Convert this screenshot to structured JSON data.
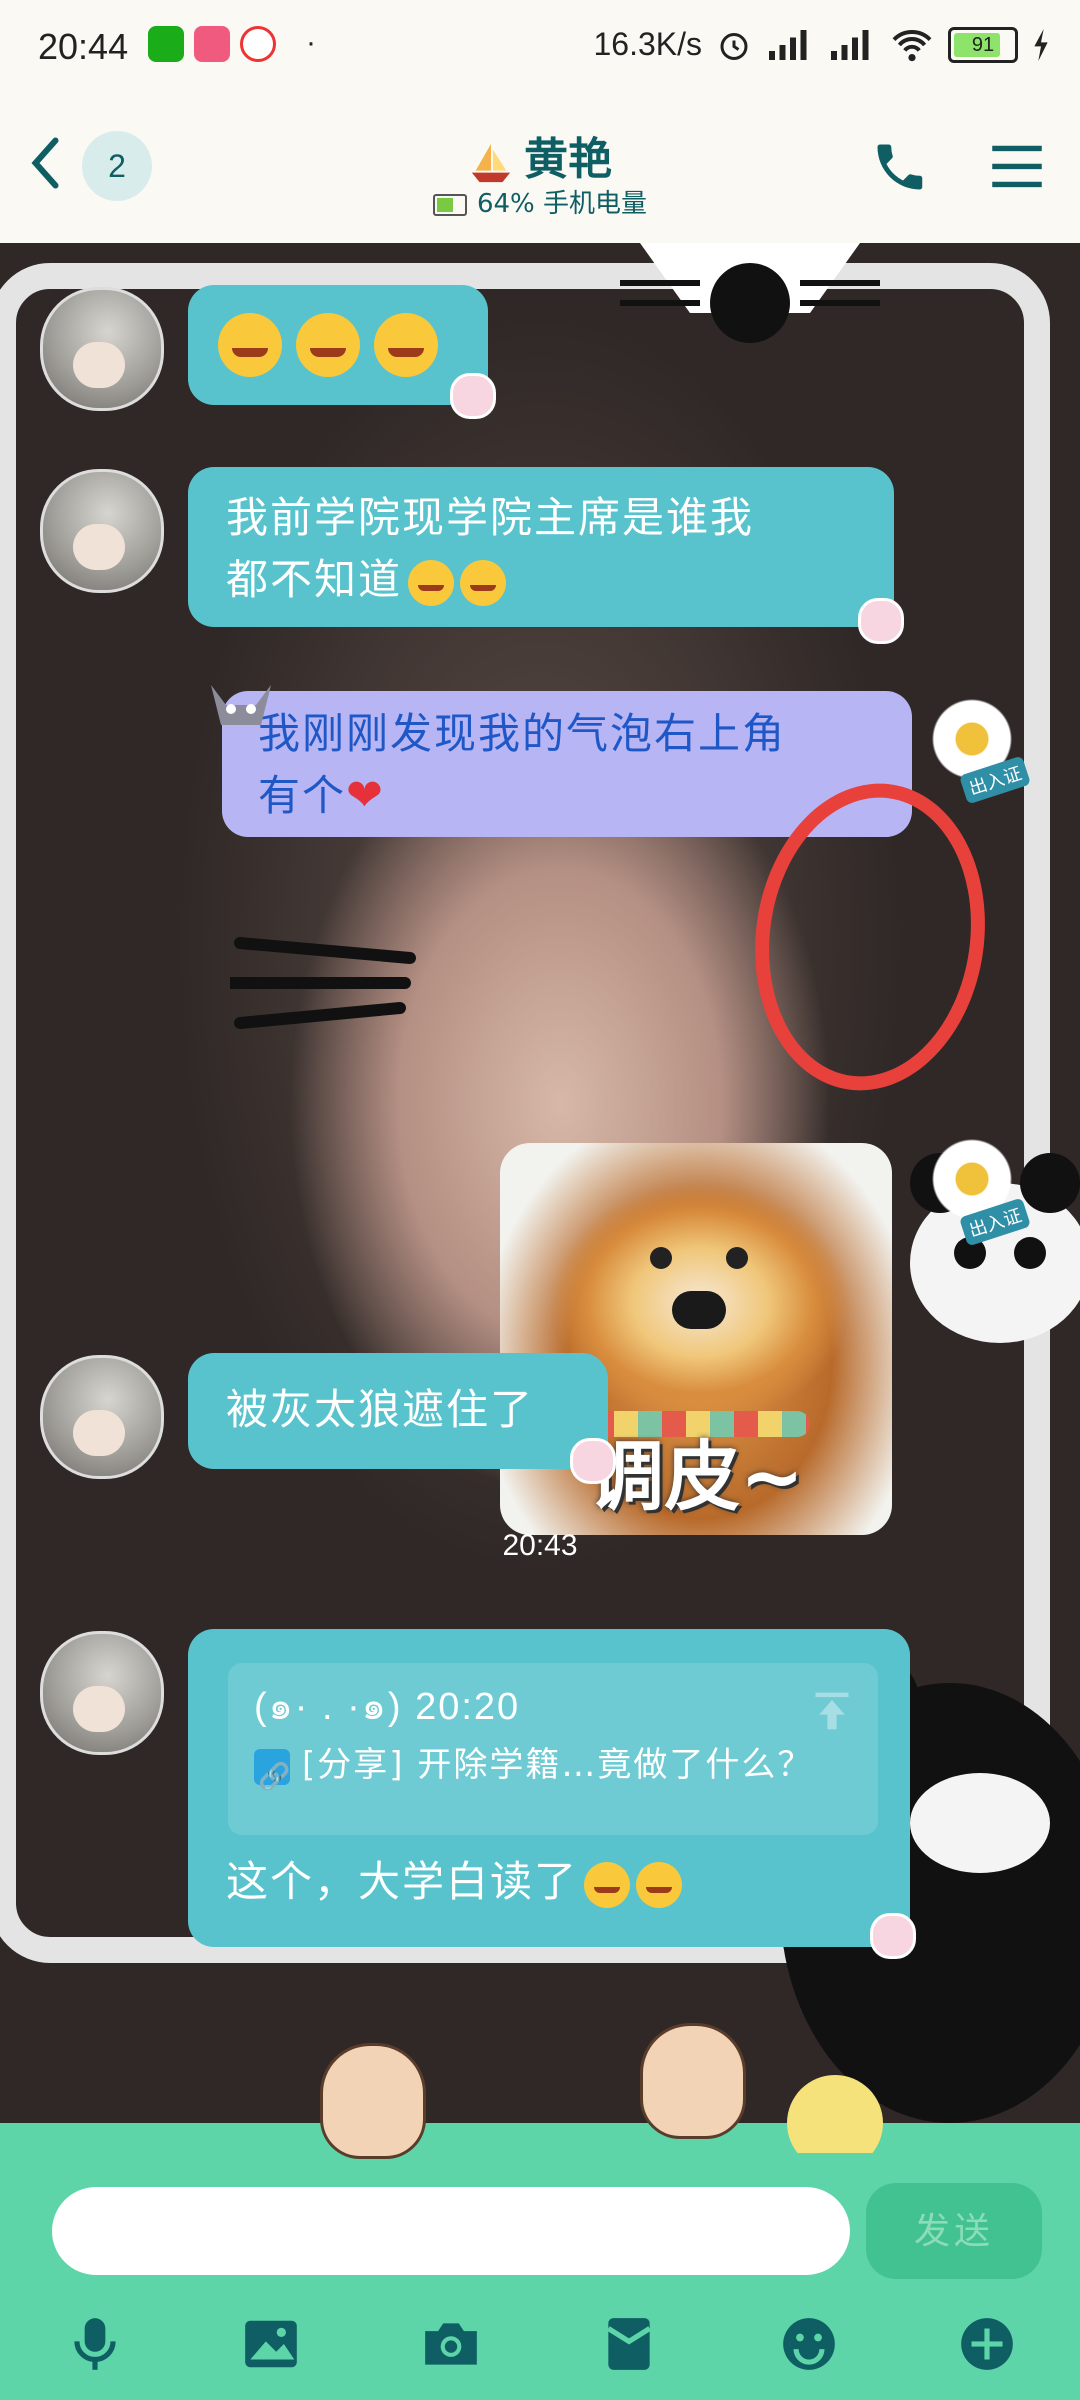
{
  "status_bar": {
    "time": "20:44",
    "dot": "·",
    "net_speed": "16.3K/s",
    "battery": "91"
  },
  "header": {
    "unread_count": "2",
    "title": "黄艳",
    "battery_text": "64% 手机电量"
  },
  "messages": [
    {
      "id": "m1",
      "side": "left",
      "type": "emoji",
      "emoji_count": 3
    },
    {
      "id": "m2",
      "side": "left",
      "type": "text",
      "text_line1": "我前学院现学院主席是谁我",
      "text_line2": "都不知道"
    },
    {
      "id": "m3",
      "side": "right",
      "type": "text",
      "text_line1": "我刚刚发现我的气泡右上角",
      "text_line2": "有个"
    },
    {
      "id": "m4",
      "side": "right",
      "type": "sticker",
      "caption": "调皮~"
    },
    {
      "id": "m5",
      "side": "left",
      "type": "text",
      "text": "被灰太狼遮住了"
    },
    {
      "id": "m6",
      "side": "left",
      "type": "quote",
      "quote_meta": "(๑· . ·๑) 20:20",
      "quote_text": "[分享] 开除学籍…竟做了什么？",
      "text": "这个，大学白读了"
    }
  ],
  "timestamp": "20:43",
  "stamp_text": "出入证",
  "composer": {
    "input_value": "",
    "send_label": "发送"
  },
  "toolbar_icons": [
    "microphone-icon",
    "image-icon",
    "camera-icon",
    "red-packet-icon",
    "emoji-icon",
    "plus-icon"
  ],
  "colors": {
    "header_bg": "#fbf9f4",
    "accent": "#0f5e63",
    "bubble_left": "#58c3cd",
    "bubble_right": "#b7b5f4",
    "composer_bg": "#5dd5a8",
    "annotation_circle": "#e8413c"
  }
}
